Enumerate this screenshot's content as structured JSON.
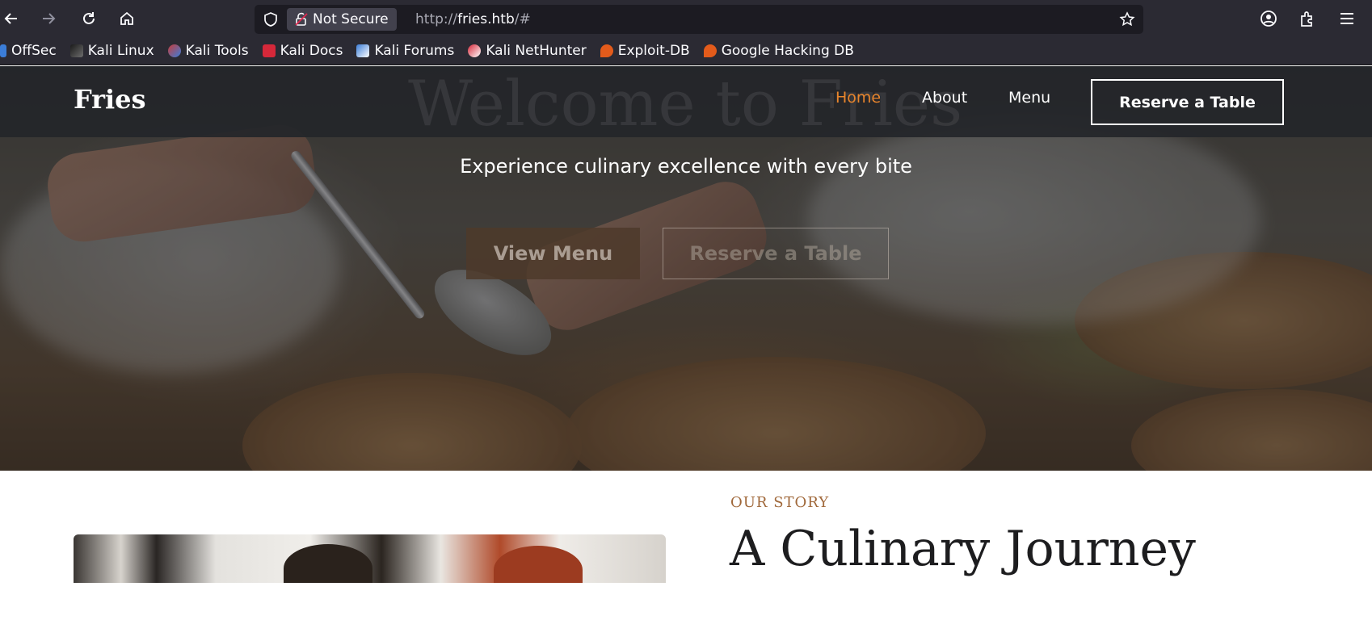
{
  "browser": {
    "not_secure_label": "Not Secure",
    "url_prefix": "http://",
    "url_host": "fries.htb",
    "url_suffix": "/#",
    "bookmarks": [
      {
        "label": "OffSec",
        "color": "#3b7dd8"
      },
      {
        "label": "Kali Linux",
        "color": "#2b2a33"
      },
      {
        "label": "Kali Tools",
        "color": "#c63d3d"
      },
      {
        "label": "Kali Docs",
        "color": "#d6283a"
      },
      {
        "label": "Kali Forums",
        "color": "#3b7dd8"
      },
      {
        "label": "Kali NetHunter",
        "color": "#d6283a"
      },
      {
        "label": "Exploit-DB",
        "color": "#e35b1b"
      },
      {
        "label": "Google Hacking DB",
        "color": "#e35b1b"
      }
    ]
  },
  "navbar": {
    "brand": "Fries",
    "ghost_title": "Welcome to Fries",
    "links": [
      "Home",
      "About",
      "Menu"
    ],
    "reserve_label": "Reserve a Table",
    "active_color": "#e8852c"
  },
  "hero": {
    "tagline": "Experience culinary excellence with every bite",
    "view_menu_label": "View Menu",
    "reserve_label": "Reserve a Table"
  },
  "story": {
    "label": "OUR STORY",
    "title": "A Culinary Journey",
    "accent_color": "#a0683a"
  }
}
